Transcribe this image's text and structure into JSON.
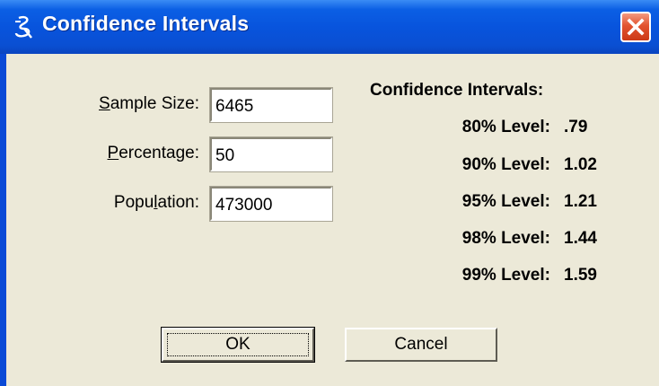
{
  "window": {
    "title": "Confidence Intervals",
    "icon": "app-icon",
    "close_icon": "close-icon",
    "titlebar_color": "#0a54dd",
    "close_color": "#e2532f",
    "body_color": "#ece9d8"
  },
  "inputs": {
    "sample_size": {
      "label_prefix": "",
      "label_access": "S",
      "label_rest": "ample Size:",
      "value": "6465"
    },
    "percentage": {
      "label_prefix": "",
      "label_access": "P",
      "label_rest": "ercentage:",
      "value": "50"
    },
    "population": {
      "label_prefix": "Popu",
      "label_access": "l",
      "label_rest": "ation:",
      "value": "473000"
    }
  },
  "results": {
    "heading": "Confidence Intervals:",
    "levels": [
      {
        "label": "80% Level:",
        "value": ".79"
      },
      {
        "label": "90% Level:",
        "value": "1.02"
      },
      {
        "label": "95% Level:",
        "value": "1.21"
      },
      {
        "label": "98% Level:",
        "value": "1.44"
      },
      {
        "label": "99% Level:",
        "value": "1.59"
      }
    ]
  },
  "buttons": {
    "ok_label": "OK",
    "cancel_label": "Cancel"
  }
}
